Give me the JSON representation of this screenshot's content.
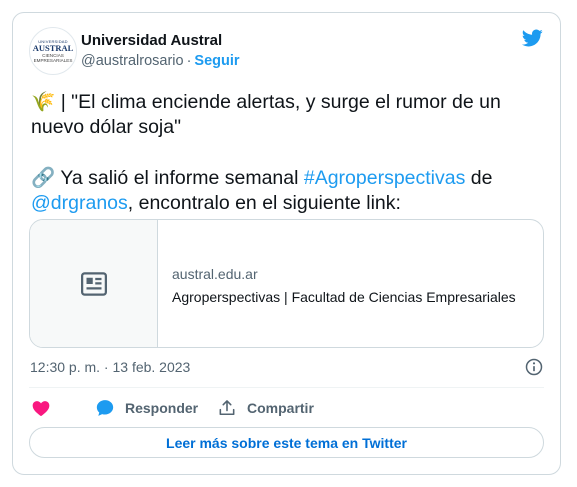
{
  "author": {
    "name": "Universidad Austral",
    "handle": "@australrosario",
    "separator": "·",
    "follow_label": "Seguir",
    "avatar": {
      "crest": "UNIVERSIDAD",
      "brand": "AUSTRAL",
      "sub_line1": "CIENCIAS",
      "sub_line2": "EMPRESARIALES"
    }
  },
  "tweet": {
    "line1_emoji": "🌾",
    "line1": "| \"El clima enciende alertas, y surge el rumor de un",
    "line2": "nuevo dólar soja\"",
    "line3_emoji": "🔗",
    "line3_pre": " Ya salió el informe semanal ",
    "hashtag": "#Agroperspectivas",
    "line3_post": " de",
    "mention": "@drgranos",
    "line4_post": ", encontralo en el siguiente link:"
  },
  "link_card": {
    "domain": "austral.edu.ar",
    "title": "Agroperspectivas | Facultad de Ciencias Empresariales",
    "thumb_icon": "newspaper-icon"
  },
  "timestamp": "12:30 p. m. · 13 feb. 2023",
  "actions": {
    "like_icon": "heart-icon",
    "reply_label": "Responder",
    "share_label": "Compartir"
  },
  "more_button_label": "Leer más sobre este tema en Twitter",
  "colors": {
    "accent": "#1d9bf0",
    "text": "#0f1419",
    "muted": "#536471",
    "border": "#cfd9de",
    "heart": "#f91880"
  }
}
